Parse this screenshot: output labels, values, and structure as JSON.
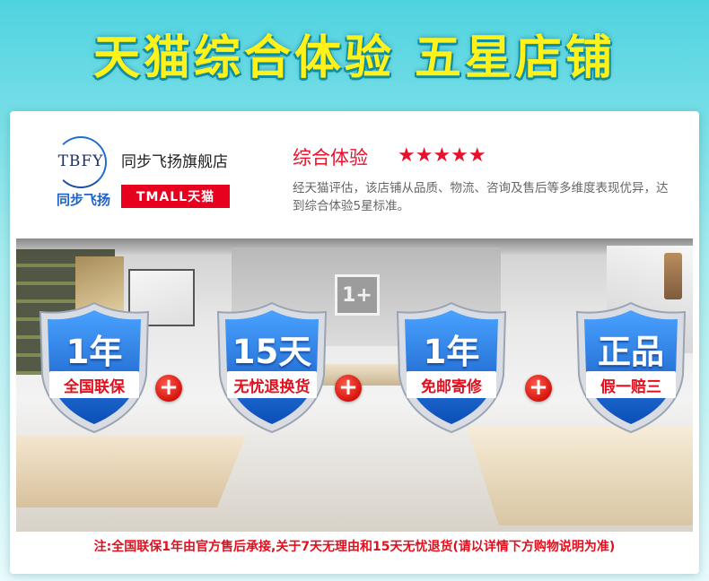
{
  "banner": {
    "title": "天猫综合体验  五星店铺"
  },
  "store": {
    "logo_text": "TBFY",
    "logo_name": "同步飞扬",
    "name": "同步飞扬旗舰店",
    "platform_badge": "TMALL天猫"
  },
  "rating": {
    "title": "综合体验",
    "stars": "★★★★★",
    "star_count": 5,
    "description": "经天猫评估，该店铺从品质、物流、咨询及售后等多维度表现优异，达到综合体验5星标准。"
  },
  "photo": {
    "brand_mark": "1+"
  },
  "guarantees": [
    {
      "number": "1年",
      "label": "全国联保"
    },
    {
      "number": "15天",
      "label": "无忧退换货"
    },
    {
      "number": "1年",
      "label": "免邮寄修"
    },
    {
      "number": "正品",
      "label": "假一赔三"
    }
  ],
  "plus_sign": "+",
  "footnote": "注:全国联保1年由官方售后承接,关于7天无理由和15天无忧退货(请以详情下方购物说明为准)",
  "colors": {
    "banner_text": "#fff21a",
    "accent_red": "#e2101e",
    "tmall_red": "#e8001f",
    "shield_blue": "#1a6fd6",
    "background": "#4fd3e0"
  }
}
